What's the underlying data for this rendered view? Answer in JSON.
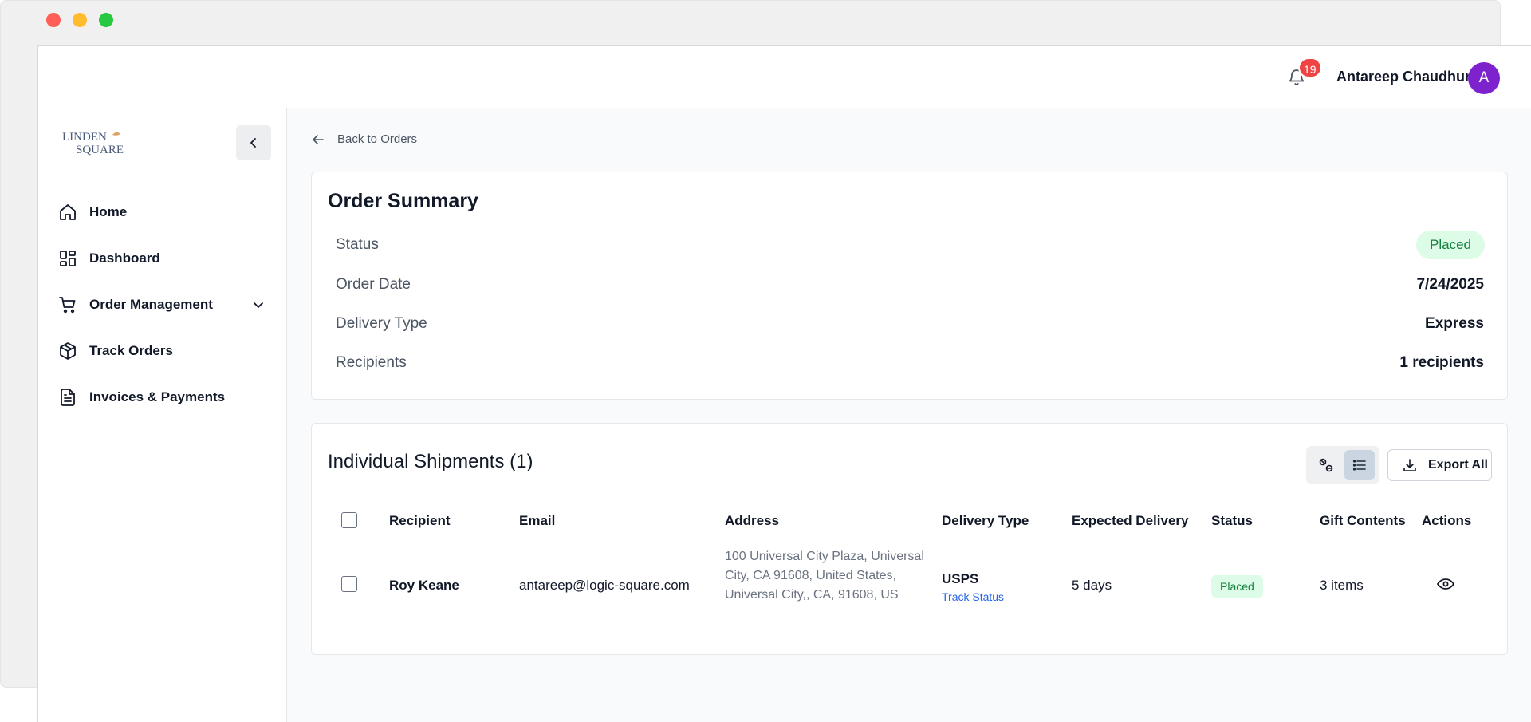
{
  "header": {
    "notification_count": "19",
    "user_name": "Antareep Chaudhuri",
    "avatar_initial": "A"
  },
  "sidebar": {
    "logo_text_top": "LINDEN",
    "logo_text_bottom": "SQUARE",
    "items": [
      {
        "label": "Home",
        "icon": "home-icon"
      },
      {
        "label": "Dashboard",
        "icon": "dashboard-icon"
      },
      {
        "label": "Order Management",
        "icon": "cart-icon",
        "expandable": true
      },
      {
        "label": "Track Orders",
        "icon": "package-icon"
      },
      {
        "label": "Invoices & Payments",
        "icon": "document-icon"
      }
    ]
  },
  "main": {
    "back_label": "Back to Orders",
    "summary": {
      "title": "Order Summary",
      "status_label": "Status",
      "status_value": "Placed",
      "order_date_label": "Order Date",
      "order_date_value": "7/24/2025",
      "delivery_type_label": "Delivery Type",
      "delivery_type_value": "Express",
      "recipients_label": "Recipients",
      "recipients_value": "1 recipients"
    },
    "shipments": {
      "title": "Individual Shipments (1)",
      "export_label": "Export All",
      "columns": [
        "Recipient",
        "Email",
        "Address",
        "Delivery Type",
        "Expected Delivery",
        "Status",
        "Gift Contents",
        "Actions"
      ],
      "rows": [
        {
          "recipient": "Roy Keane",
          "email": "antareep@logic-square.com",
          "address": "100 Universal City Plaza, Universal City, CA 91608, United States, Universal City,, CA, 91608, US",
          "carrier": "USPS",
          "track_label": "Track Status",
          "expected": "5 days",
          "status": "Placed",
          "gift_contents": "3 items"
        }
      ]
    }
  },
  "colors": {
    "accent_avatar": "#7e22ce",
    "badge": "#ef4444",
    "status_bg": "#dcfce7",
    "status_text": "#15803d",
    "link": "#2563eb"
  }
}
